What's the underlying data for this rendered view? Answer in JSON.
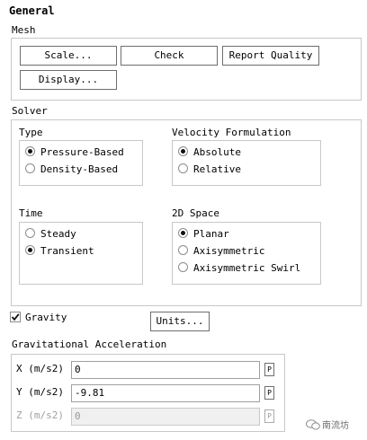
{
  "title": "General",
  "mesh": {
    "label": "Mesh",
    "buttons": {
      "scale": "Scale...",
      "check": "Check",
      "report_quality": "Report Quality",
      "display": "Display..."
    }
  },
  "solver": {
    "label": "Solver",
    "type": {
      "label": "Type",
      "options": [
        "Pressure-Based",
        "Density-Based"
      ],
      "selected": "Pressure-Based"
    },
    "velocity_formulation": {
      "label": "Velocity Formulation",
      "options": [
        "Absolute",
        "Relative"
      ],
      "selected": "Absolute"
    },
    "time": {
      "label": "Time",
      "options": [
        "Steady",
        "Transient"
      ],
      "selected": "Transient"
    },
    "space_2d": {
      "label": "2D Space",
      "options": [
        "Planar",
        "Axisymmetric",
        "Axisymmetric Swirl"
      ],
      "selected": "Planar"
    }
  },
  "gravity": {
    "label": "Gravity",
    "checked": true
  },
  "units_button": "Units...",
  "gravitational_acceleration": {
    "label": "Gravitational Acceleration",
    "x": {
      "label": "X (m/s2)",
      "value": "0",
      "p": "P"
    },
    "y": {
      "label": "Y (m/s2)",
      "value": "-9.81",
      "p": "P"
    },
    "z": {
      "label": "Z (m/s2)",
      "value": "0",
      "p": "P",
      "disabled": true
    }
  },
  "watermark": "南流坊"
}
